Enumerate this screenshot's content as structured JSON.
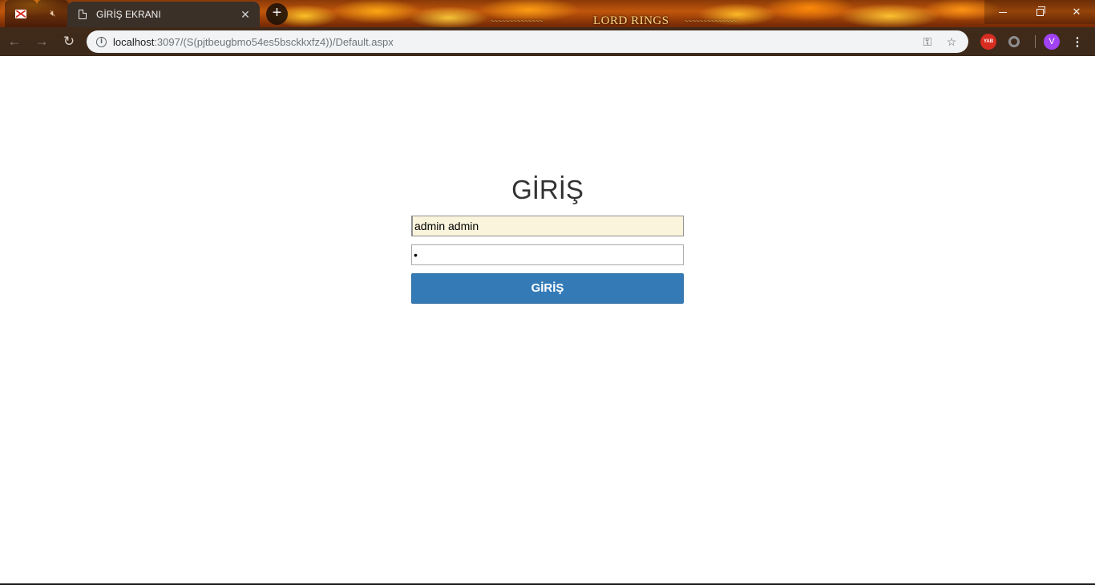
{
  "browser": {
    "active_tab_title": "GİRİŞ EKRANI",
    "tab_close": "✕",
    "new_tab": "+",
    "url_host": "localhost",
    "url_rest": ":3097/(S(pjtbeugbmo54es5bsckkxfz4))/Default.aspx",
    "theme_logo": "LORD RINGS",
    "extension_badge": "YAB",
    "profile_initial": "V",
    "icons": [
      "gmail-icon",
      "muted-speaker-icon",
      "page-icon",
      "back-arrow-icon",
      "forward-arrow-icon",
      "reload-icon",
      "info-icon",
      "key-icon",
      "star-icon",
      "menu-icon"
    ]
  },
  "login": {
    "title": "GİRİŞ",
    "username_value": "admin admin",
    "password_value": "•",
    "submit_label": "GİRİŞ"
  },
  "colors": {
    "button": "#337ab7",
    "autofill": "#faf4dc",
    "title": "#333333"
  }
}
